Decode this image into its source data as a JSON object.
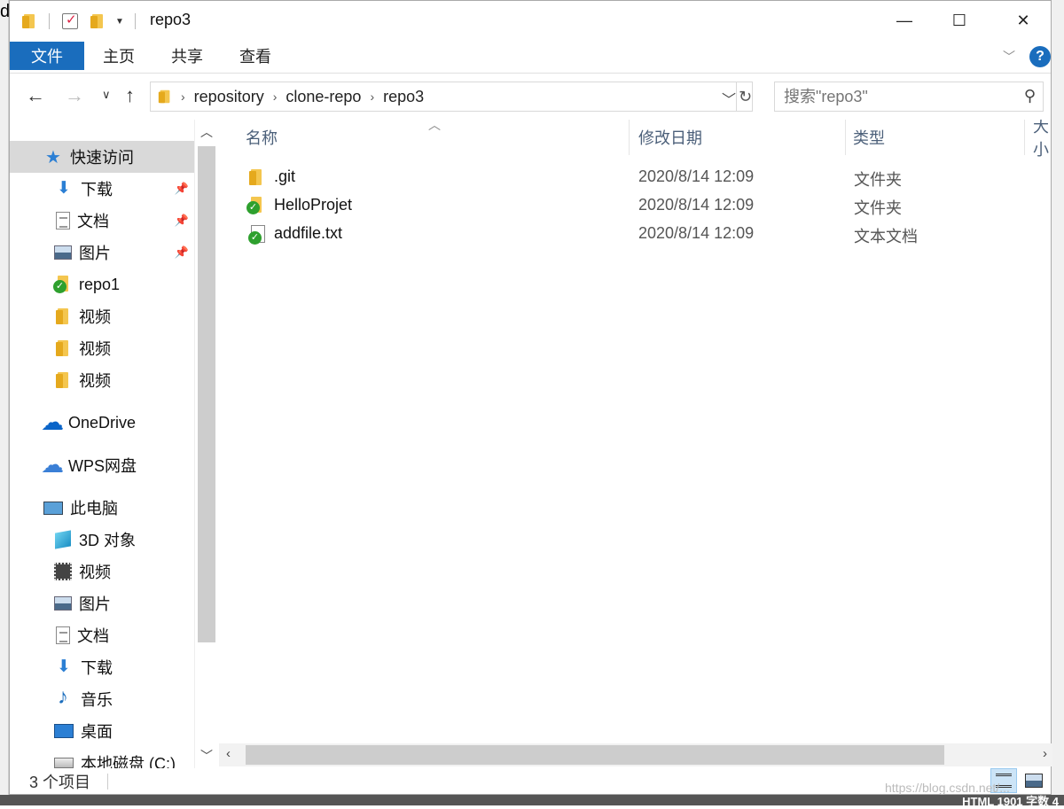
{
  "window": {
    "title": "repo3"
  },
  "ribbon": {
    "tabs": [
      {
        "label": "文件",
        "active": true
      },
      {
        "label": "主页"
      },
      {
        "label": "共享"
      },
      {
        "label": "查看"
      }
    ],
    "help_icon": "?"
  },
  "address": {
    "crumbs": [
      "repository",
      "clone-repo",
      "repo3"
    ]
  },
  "search": {
    "placeholder": "搜索\"repo3\""
  },
  "navigation": {
    "quick_access": "快速访问",
    "items": [
      {
        "label": "下载",
        "icon": "download-icon",
        "pinned": true
      },
      {
        "label": "文档",
        "icon": "document-icon",
        "pinned": true
      },
      {
        "label": "图片",
        "icon": "picture-icon",
        "pinned": true
      },
      {
        "label": "repo1",
        "icon": "git-folder-icon"
      },
      {
        "label": "视频",
        "icon": "folder-icon"
      },
      {
        "label": "视频",
        "icon": "folder-icon"
      },
      {
        "label": "视频",
        "icon": "folder-icon"
      }
    ],
    "onedrive": "OneDrive",
    "wps": "WPS网盘",
    "this_pc": "此电脑",
    "pc_items": [
      {
        "label": "3D 对象",
        "icon": "3d-objects-icon"
      },
      {
        "label": "视频",
        "icon": "video-icon"
      },
      {
        "label": "图片",
        "icon": "picture-icon"
      },
      {
        "label": "文档",
        "icon": "document-icon"
      },
      {
        "label": "下载",
        "icon": "download-icon"
      },
      {
        "label": "音乐",
        "icon": "music-icon"
      },
      {
        "label": "桌面",
        "icon": "desktop-icon"
      },
      {
        "label": "本地磁盘 (C:)",
        "icon": "drive-icon"
      }
    ]
  },
  "columns": {
    "name": "名称",
    "date": "修改日期",
    "type": "类型",
    "size": "大小"
  },
  "files": [
    {
      "name": ".git",
      "date": "2020/8/14 12:09",
      "type": "文件夹",
      "icon": "folder-icon"
    },
    {
      "name": "HelloProjet",
      "date": "2020/8/14 12:09",
      "type": "文件夹",
      "icon": "git-folder-icon"
    },
    {
      "name": "addfile.txt",
      "date": "2020/8/14 12:09",
      "type": "文本文档",
      "icon": "text-file-git-icon"
    }
  ],
  "status": {
    "count": "3 个项目"
  },
  "background": {
    "left_letter": "d",
    "bottom_text": "HTML  1901 字数  4"
  },
  "watermark": "https://blog.csdn.net/..."
}
